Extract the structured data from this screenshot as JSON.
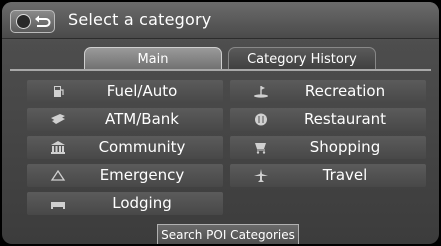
{
  "header": {
    "title": "Select a category"
  },
  "tabs": [
    {
      "label": "Main"
    },
    {
      "label": "Category History"
    }
  ],
  "categories": {
    "left": [
      {
        "label": "Fuel/Auto",
        "icon": "fuel-pump-icon"
      },
      {
        "label": "ATM/Bank",
        "icon": "atm-card-icon"
      },
      {
        "label": "Community",
        "icon": "building-icon"
      },
      {
        "label": "Emergency",
        "icon": "triangle-icon"
      },
      {
        "label": "Lodging",
        "icon": "bed-icon"
      }
    ],
    "right": [
      {
        "label": "Recreation",
        "icon": "golf-flag-icon"
      },
      {
        "label": "Restaurant",
        "icon": "plate-icon"
      },
      {
        "label": "Shopping",
        "icon": "shopping-cart-icon"
      },
      {
        "label": "Travel",
        "icon": "airplane-icon"
      }
    ]
  },
  "footer": {
    "search_label": "Search POI Categories"
  },
  "colors": {
    "text": "#ffffff",
    "icon": "#d0d0d0",
    "background": "#3f3f3f"
  }
}
